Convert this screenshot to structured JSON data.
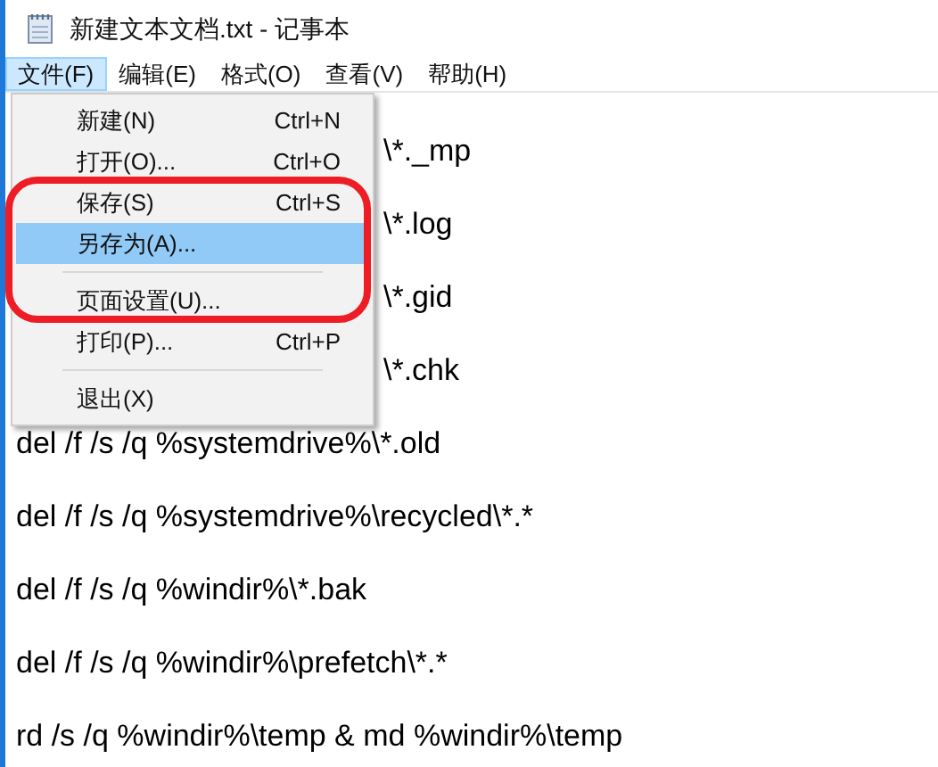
{
  "window": {
    "title": "新建文本文档.txt - 记事本"
  },
  "menu_bar": [
    {
      "label": "文件(F)",
      "selected": true
    },
    {
      "label": "编辑(E)",
      "selected": false
    },
    {
      "label": "格式(O)",
      "selected": false
    },
    {
      "label": "查看(V)",
      "selected": false
    },
    {
      "label": "帮助(H)",
      "selected": false
    }
  ],
  "file_menu": [
    {
      "kind": "item",
      "label": "新建(N)",
      "shortcut": "Ctrl+N",
      "selected": false
    },
    {
      "kind": "item",
      "label": "打开(O)...",
      "shortcut": "Ctrl+O",
      "selected": false
    },
    {
      "kind": "item",
      "label": "保存(S)",
      "shortcut": "Ctrl+S",
      "selected": false
    },
    {
      "kind": "item",
      "label": "另存为(A)...",
      "selected": true
    },
    {
      "kind": "separator"
    },
    {
      "kind": "item",
      "label": "页面设置(U)...",
      "selected": false
    },
    {
      "kind": "item",
      "label": "打印(P)...",
      "shortcut": "Ctrl+P",
      "selected": false
    },
    {
      "kind": "separator"
    },
    {
      "kind": "item",
      "label": "退出(X)",
      "selected": false
    }
  ],
  "editor_lines": [
    {
      "kind": "partial",
      "text": "\\*._mp"
    },
    {
      "kind": "partial",
      "text": "\\*.log"
    },
    {
      "kind": "partial",
      "text": "\\*.gid"
    },
    {
      "kind": "partial",
      "text": "\\*.chk"
    },
    {
      "kind": "full",
      "text": "del /f /s /q %systemdrive%\\*.old"
    },
    {
      "kind": "full",
      "text": "del /f /s /q %systemdrive%\\recycled\\*.*"
    },
    {
      "kind": "full",
      "text": "del /f /s /q %windir%\\*.bak"
    },
    {
      "kind": "full",
      "text": "del /f /s /q %windir%\\prefetch\\*.*"
    },
    {
      "kind": "full",
      "text": "rd /s /q %windir%\\temp & md %windir%\\temp"
    }
  ]
}
